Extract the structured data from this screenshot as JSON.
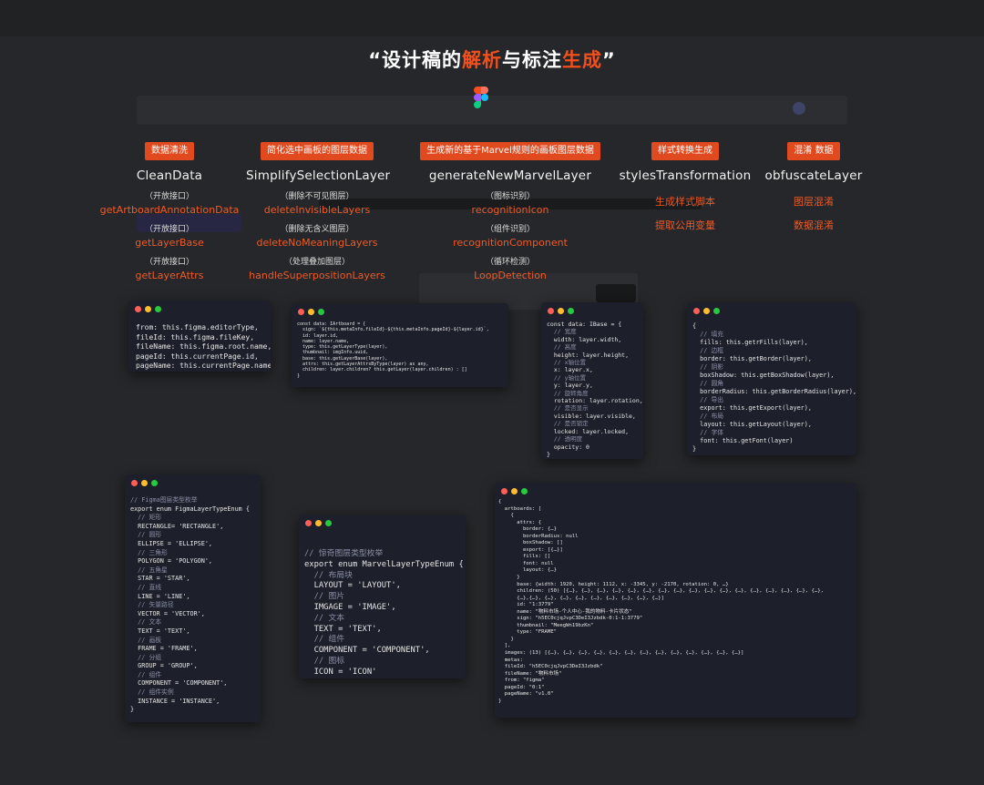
{
  "heading": {
    "quote_open": "“",
    "part1": "设计稿的",
    "part2": "解析",
    "part3": "与标注",
    "part4": "生成",
    "quote_close": "”"
  },
  "colors": {
    "accent": "#f0501e",
    "background": "#26272a",
    "window": "#1d1f2a"
  },
  "icons": {
    "brand": "figma-logo-icon"
  },
  "columns": [
    {
      "tag": "数据清洗",
      "name": "CleanData",
      "items": [
        {
          "sub": "（开放接口）",
          "fn": "getArtboardAnnotationData"
        },
        {
          "sub": "（开放接口）",
          "fn": "getLayerBase"
        },
        {
          "sub": "（开放接口）",
          "fn": "getLayerAttrs"
        }
      ]
    },
    {
      "tag": "简化选中画板的图层数据",
      "name": "SimplifySelectionLayer",
      "items": [
        {
          "sub": "（删除不可见图层）",
          "fn": "deleteInvisibleLayers"
        },
        {
          "sub": "（删除无含义图层）",
          "fn": "deleteNoMeaningLayers"
        },
        {
          "sub": "（处理叠加图层）",
          "fn": "handleSuperpositionLayers"
        }
      ]
    },
    {
      "tag": "生成新的基于Marvel规则的画板图层数据",
      "name": "generateNewMarvelLayer",
      "items": [
        {
          "sub": "（图标识别）",
          "fn": "recognitionIcon"
        },
        {
          "sub": "（组件识别）",
          "fn": "recognitionComponent"
        },
        {
          "sub": "（循环检测）",
          "fn": "LoopDetection"
        }
      ]
    },
    {
      "tag": "样式转换生成",
      "name": "stylesTransformation",
      "lines": [
        "生成样式脚本",
        "提取公用变量"
      ]
    },
    {
      "tag": "混淆 数据",
      "name": "obfuscateLayer",
      "lines": [
        "图层混淆",
        "数据混淆"
      ]
    }
  ],
  "code": {
    "clean": [
      "from: this.figma.editorType,",
      "fileId: this.figma.fileKey,",
      "fileName: this.figma.root.name,",
      "pageId: this.currentPage.id,",
      "pageName: this.currentPage.name,"
    ],
    "simplify": [
      "const data: IArtboard = {",
      "  sign: `${this.metaInfo.fileId}-${this.metaInfo.pageId}-${layer.id}`,",
      "  id: layer.id,",
      "  name: layer.name,",
      "  type: this.getLayerType(layer),",
      "  thumbnail: imgInfo.uuid,",
      "  base: this.getLayerBase(layer),",
      "  attrs: this.getLayerAttrsByType(layer) as any,",
      "  children: layer.children? this.getLayer(layer.children) : []",
      "}"
    ],
    "marvel": [
      "const data: IBase = {",
      "  // 宽度",
      "  width: layer.width,",
      "  // 高度",
      "  height: layer.height,",
      "  // x轴位置",
      "  x: layer.x,",
      "  // y轴位置",
      "  y: layer.y,",
      "  // 旋转角度",
      "  rotation: layer.rotation,",
      "  // 是否显示",
      "  visible: layer.visible,",
      "  // 是否锁定",
      "  locked: layer.locked,",
      "  // 透明度",
      "  opacity: 0",
      "}"
    ],
    "styles": [
      "{",
      "  // 填充",
      "  fills: this.getrFills(layer),",
      "  // 边框",
      "  border: this.getBorder(layer),",
      "  // 阴影",
      "  boxShadow: this.getBoxShadow(layer),",
      "  // 圆角",
      "  borderRadius: this.getBorderRadius(layer),",
      "  // 导出",
      "  export: this.getExport(layer),",
      "  // 布局",
      "  layout: this.getLayout(layer),",
      "  // 字体",
      "  font: this.getFont(layer)",
      "}"
    ],
    "figma_enum": [
      "// Figma图层类型枚举",
      "export enum FigmaLayerTypeEnum {",
      "  // 矩形",
      "  RECTANGLE= 'RECTANGLE',",
      "  // 圆形",
      "  ELLIPSE = 'ELLIPSE',",
      "  // 三角形",
      "  POLYGON = 'POLYGON',",
      "  // 五角星",
      "  STAR = 'STAR',",
      "  // 直线",
      "  LINE = 'LINE',",
      "  // 矢量路径",
      "  VECTOR = 'VECTOR',",
      "  // 文本",
      "  TEXT = 'TEXT',",
      "  // 画板",
      "  FRAME = 'FRAME',",
      "  // 分组",
      "  GROUP = 'GROUP',",
      "  // 组件",
      "  COMPONENT = 'COMPONENT',",
      "  // 组件实例",
      "  INSTANCE = 'INSTANCE',",
      "}"
    ],
    "marvel_enum": [
      "// 惊奇图层类型枚举",
      "export enum MarvelLayerTypeEnum {",
      "  // 布局块",
      "  LAYOUT = 'LAYOUT',",
      "  // 图片",
      "  IMGAGE = 'IMAGE',",
      "  // 文本",
      "  TEXT = 'TEXT',",
      "  // 组件",
      "  COMPONENT = 'COMPONENT',",
      "  // 图标",
      "  ICON = 'ICON'",
      "}"
    ],
    "output": [
      "{",
      "  artboards: [",
      "    {",
      "      attrs: {",
      "        border: {…}",
      "        borderRadius: null",
      "        boxShadow: []",
      "        export: [{…}]",
      "        fills: []",
      "        font: null",
      "        layout: {…}",
      "      }",
      "      base: {width: 1920, height: 1112, x: -3345, y: -2170, rotation: 0, …}",
      "      children: (50) [{…}, {…}, {…}, {…}, {…}, {…}, {…}, {…}, {…}, {…}, {…}, {…}, {…}, {…}, {…}, {…}, {…},",
      "      {…},{…}, {…}, {…}, {…}, {…}, {…}, {…}, {…}, {…}]",
      "      id: \"1:3779\"",
      "      name: \"物料市场-个人中心-我的物料-卡片状态\"",
      "      sign: \"h5EC0cjqJvpC3DeI3Jzbdk-0:1-1:3779\"",
      "      thumbnail: \"MeegWn19bzKn\"",
      "      type: \"FRAME\"",
      "    }",
      "  ],",
      "  images: (13) [{…}, {…}, {…}, {…}, {…}, {…}, {…}, {…}, {…}, {…}, {…}, {…}, {…}]",
      "  metas:",
      "  fileId: \"h5EC0cjqJvpC3DeI3Jzbdk\"",
      "  fileName: \"物料市场\"",
      "  from: \"figma\"",
      "  pageId: \"0:1\"",
      "  pageName: \"v1.0\"",
      "}"
    ]
  }
}
